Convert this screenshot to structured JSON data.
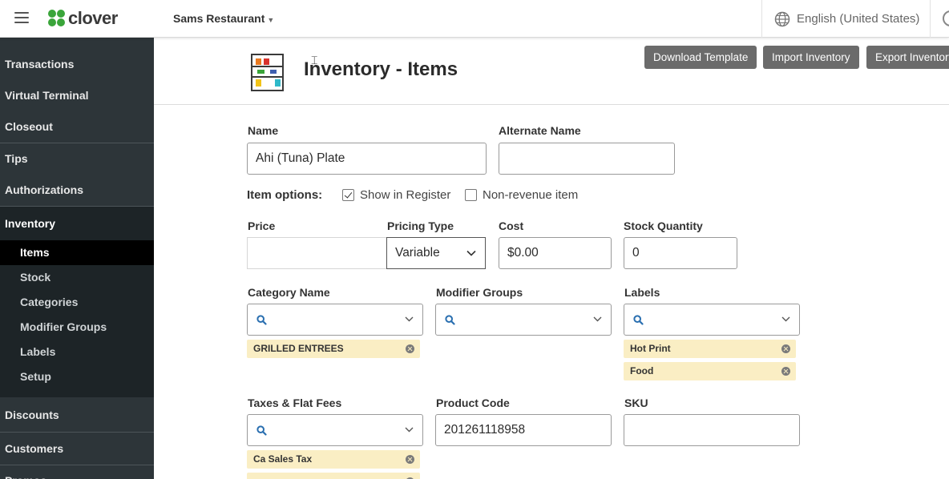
{
  "topbar": {
    "logo_text": "clover",
    "merchant_name": "Sams Restaurant",
    "language": "English (United States)"
  },
  "sidebar": {
    "items": [
      {
        "label": "Transactions"
      },
      {
        "label": "Virtual Terminal"
      },
      {
        "label": "Closeout"
      },
      {
        "label": "Tips"
      },
      {
        "label": "Authorizations"
      },
      {
        "label": "Inventory"
      },
      {
        "label": "Discounts"
      },
      {
        "label": "Customers"
      },
      {
        "label": "Promos"
      }
    ],
    "inventory_sub": [
      {
        "label": "Items"
      },
      {
        "label": "Stock"
      },
      {
        "label": "Categories"
      },
      {
        "label": "Modifier Groups"
      },
      {
        "label": "Labels"
      },
      {
        "label": "Setup"
      }
    ]
  },
  "header": {
    "title": "Inventory - Items",
    "buttons": {
      "download": "Download Template",
      "import": "Import Inventory",
      "export": "Export Inventory"
    }
  },
  "form": {
    "name_label": "Name",
    "name_value": "Ahi (Tuna) Plate",
    "alt_name_label": "Alternate Name",
    "alt_name_value": "",
    "item_options_label": "Item options:",
    "show_in_register_label": "Show in Register",
    "show_in_register_checked": true,
    "non_revenue_label": "Non-revenue item",
    "non_revenue_checked": false,
    "price_label": "Price",
    "price_value": "",
    "pricing_type_label": "Pricing Type",
    "pricing_type_value": "Variable",
    "cost_label": "Cost",
    "cost_value": "$0.00",
    "stock_label": "Stock Quantity",
    "stock_value": "0",
    "category_label": "Category Name",
    "category_chips": [
      "GRILLED ENTREES"
    ],
    "modifier_label": "Modifier Groups",
    "labels_label": "Labels",
    "label_chips": [
      "Hot Print",
      "Food"
    ],
    "taxes_label": "Taxes & Flat Fees",
    "tax_chips": [
      "Ca Sales Tax"
    ],
    "product_code_label": "Product Code",
    "product_code_value": "201261118958",
    "sku_label": "SKU",
    "sku_value": ""
  },
  "colors": {
    "sidebar_bg": "#2d3539",
    "sidebar_active_bg": "#1d2427",
    "brand_green": "#3aa53a",
    "button_gray": "#6b6b6b",
    "chip_bg": "#faeec4",
    "search_icon_blue": "#2a6fb0"
  }
}
